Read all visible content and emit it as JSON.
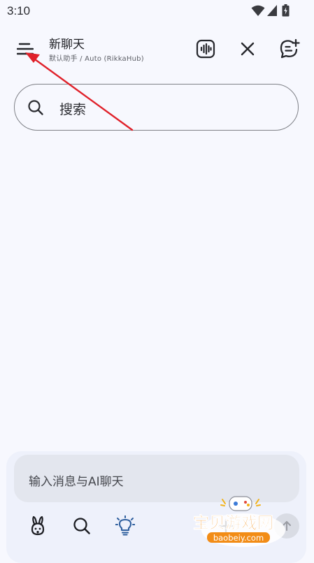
{
  "status_bar": {
    "time": "3:10",
    "icons": [
      "wifi-icon",
      "signal-icon",
      "battery-icon"
    ]
  },
  "header": {
    "title": "新聊天",
    "subtitle": "默认助手 / Auto (RikkaHub)",
    "buttons": [
      "menu-icon",
      "voice-wave-icon",
      "close-icon",
      "new-chat-icon"
    ]
  },
  "search": {
    "placeholder": "搜索"
  },
  "composer": {
    "placeholder": "输入消息与AI聊天",
    "tools": [
      "rabbit-icon",
      "search-icon",
      "lightbulb-icon"
    ]
  },
  "watermark": {
    "text": "宝贝游戏网",
    "url": "baobeiy.com"
  },
  "colors": {
    "background": "#f7f8fe",
    "annotation_arrow": "#e0212a",
    "lightbulb_accent": "#2f5f9e",
    "watermark_orange": "#f28c16"
  }
}
